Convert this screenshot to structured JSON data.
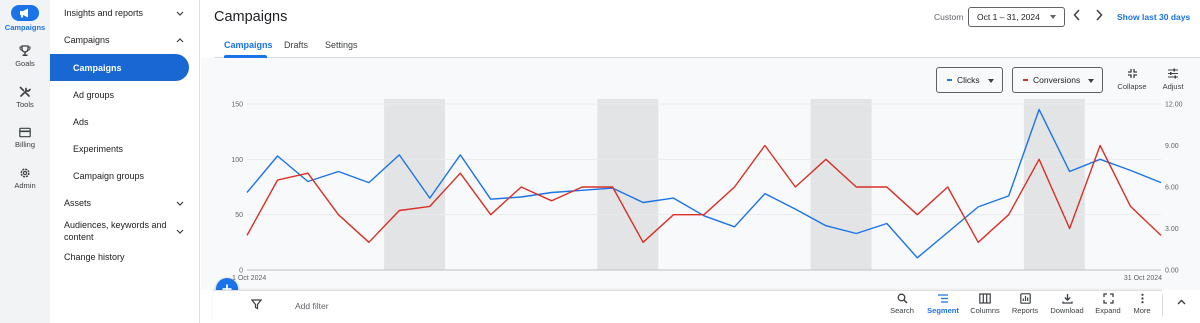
{
  "rail": {
    "items": [
      {
        "label": "Campaigns",
        "icon": "megaphone-icon",
        "active": true
      },
      {
        "label": "Goals",
        "icon": "trophy-icon"
      },
      {
        "label": "Tools",
        "icon": "tools-icon"
      },
      {
        "label": "Billing",
        "icon": "credit-card-icon"
      },
      {
        "label": "Admin",
        "icon": "gear-icon"
      }
    ]
  },
  "nav": {
    "insights": "Insights and reports",
    "campaigns_group": "Campaigns",
    "campaigns": "Campaigns",
    "ad_groups": "Ad groups",
    "ads": "Ads",
    "experiments": "Experiments",
    "campaign_groups": "Campaign groups",
    "assets": "Assets",
    "audiences_line1": "Audiences, keywords and",
    "audiences_line2": "content",
    "change_history": "Change history"
  },
  "header": {
    "title": "Campaigns",
    "custom_label": "Custom",
    "date_range": "Oct 1 – 31, 2024",
    "show_last": "Show last 30 days"
  },
  "tabs": [
    "Campaigns",
    "Drafts",
    "Settings"
  ],
  "metrics": {
    "metric1": {
      "label": "Clicks",
      "color": "#1a73e8"
    },
    "metric2": {
      "label": "Conversions",
      "color": "#d93025"
    }
  },
  "chart_tools": {
    "collapse": "Collapse",
    "adjust": "Adjust"
  },
  "chart_data": {
    "type": "line",
    "x_start_label": "1 Oct 2024",
    "x_end_label": "31 Oct 2024",
    "x": [
      1,
      2,
      3,
      4,
      5,
      6,
      7,
      8,
      9,
      10,
      11,
      12,
      13,
      14,
      15,
      16,
      17,
      18,
      19,
      20,
      21,
      22,
      23,
      24,
      25,
      26,
      27,
      28,
      29,
      30,
      31
    ],
    "left_axis": {
      "ticks": [
        "0",
        "50",
        "100",
        "150"
      ],
      "ylim": [
        0,
        150
      ]
    },
    "right_axis": {
      "ticks": [
        "0.00",
        "3.00",
        "6.00",
        "9.00",
        "12.00"
      ],
      "ylim": [
        0,
        12
      ]
    },
    "weekend_bands": [
      [
        6,
        7
      ],
      [
        13,
        14
      ],
      [
        20,
        21
      ],
      [
        27,
        28
      ]
    ],
    "series": [
      {
        "name": "Clicks",
        "axis": "left",
        "color": "#1a73e8",
        "values": [
          70,
          103,
          80,
          89,
          79,
          104,
          65,
          104,
          64,
          66,
          70,
          72,
          74,
          61,
          65,
          49,
          39,
          69,
          55,
          40,
          33,
          42,
          11,
          34,
          57,
          67,
          145,
          89,
          100,
          90,
          79
        ]
      },
      {
        "name": "Conversions",
        "axis": "right",
        "color": "#d93025",
        "values": [
          2.5,
          6.5,
          7.0,
          4.0,
          2.0,
          4.3,
          4.6,
          7.0,
          4.0,
          6.0,
          5.0,
          6.0,
          6.0,
          2.0,
          4.0,
          4.0,
          6.0,
          9.0,
          6.0,
          8.0,
          6.0,
          6.0,
          4.0,
          6.0,
          2.0,
          4.0,
          8.0,
          3.0,
          9.0,
          4.6,
          2.5
        ]
      }
    ],
    "grid": true
  },
  "toolbar": {
    "add_filter": "Add filter",
    "buttons": [
      {
        "label": "Search",
        "icon": "search-icon"
      },
      {
        "label": "Segment",
        "icon": "segment-icon",
        "active": true
      },
      {
        "label": "Columns",
        "icon": "columns-icon"
      },
      {
        "label": "Reports",
        "icon": "reports-icon"
      },
      {
        "label": "Download",
        "icon": "download-icon"
      },
      {
        "label": "Expand",
        "icon": "expand-icon"
      },
      {
        "label": "More",
        "icon": "more-vert-icon"
      }
    ]
  }
}
